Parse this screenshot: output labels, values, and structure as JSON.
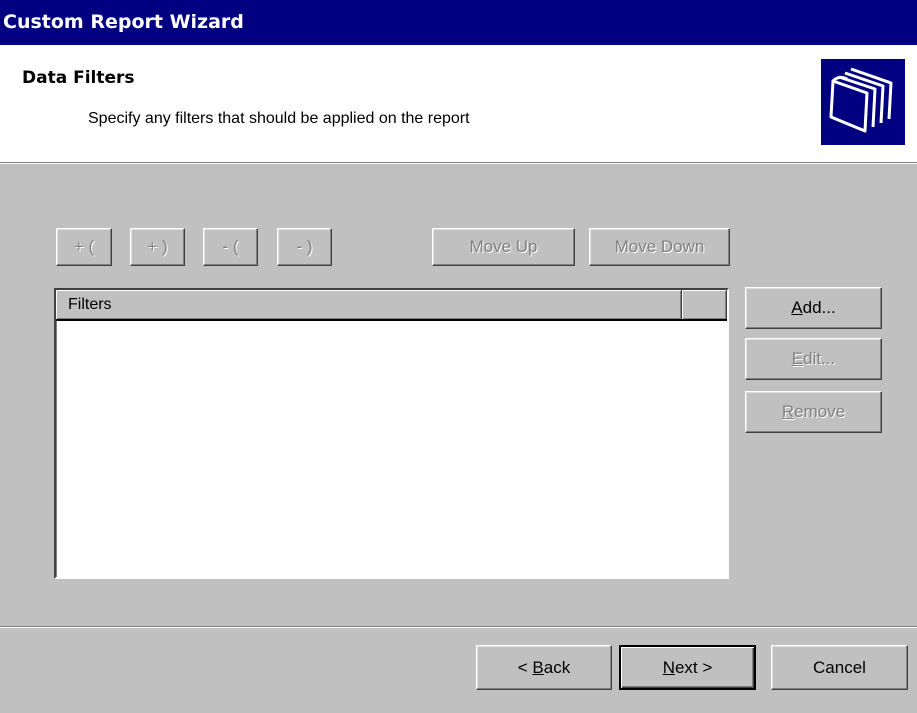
{
  "window": {
    "title": "Custom Report Wizard"
  },
  "header": {
    "title": "Data Filters",
    "subtitle": "Specify any filters that should be applied on the report",
    "icon": "folders-icon"
  },
  "toolbar": {
    "add_open_paren": "+ (",
    "add_close_paren": "+ )",
    "remove_open_paren": "- (",
    "remove_close_paren": "- )",
    "move_up": "Move Up",
    "move_down": "Move Down"
  },
  "filters_list": {
    "columns": [
      "Filters",
      ""
    ],
    "rows": []
  },
  "side_buttons": {
    "add": {
      "prefix": "",
      "accel": "A",
      "rest": "dd..."
    },
    "edit": {
      "prefix": "",
      "accel": "E",
      "rest": "dit..."
    },
    "remove": {
      "prefix": "",
      "accel": "R",
      "rest": "emove"
    }
  },
  "footer": {
    "back": {
      "prefix": "< ",
      "accel": "B",
      "rest": "ack"
    },
    "next": {
      "prefix": "",
      "accel": "N",
      "rest": "ext >"
    },
    "cancel": "Cancel"
  },
  "colors": {
    "titlebar": "#000080",
    "face": "#c0c0c0",
    "disabled_text": "#808080"
  }
}
